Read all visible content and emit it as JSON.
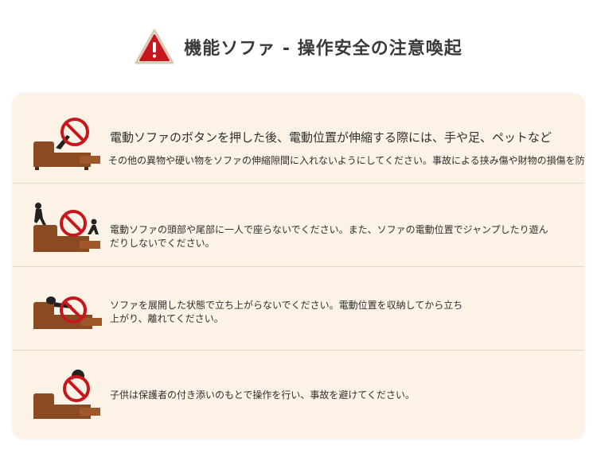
{
  "header": {
    "title": "機能ソファ - 操作安全の注意喚起",
    "icon": "warning-triangle-icon"
  },
  "colors": {
    "accent_red": "#c8161d",
    "sofa_brown": "#8a4a22",
    "panel_bg": "#fcf3e6"
  },
  "items": [
    {
      "icon": "no-hands-in-mechanism-icon",
      "line1": "電動ソファのボタンを押した後、電動位置が伸縮する際には、手や足、ペットなど",
      "line2": "その他の異物や硬い物をソファの伸縮隙間に入れないようにしてください。事故による挟み傷や財物の損傷を防ぎま"
    },
    {
      "icon": "no-sitting-on-ends-icon",
      "line1": "電動ソファの頭部や尾部に一人で座らないでください。また、ソファの電動位置でジャンプしたり遊ん",
      "line2": "だりしないでください。"
    },
    {
      "icon": "no-standing-up-extended-icon",
      "line1": "ソファを展開した状態で立ち上がらないでください。電動位置を収納してから立ち",
      "line2": "上がり、離れてください。"
    },
    {
      "icon": "child-supervision-icon",
      "line1": "子供は保護者の付き添いのもとで操作を行い、事故を避けてください。"
    }
  ]
}
